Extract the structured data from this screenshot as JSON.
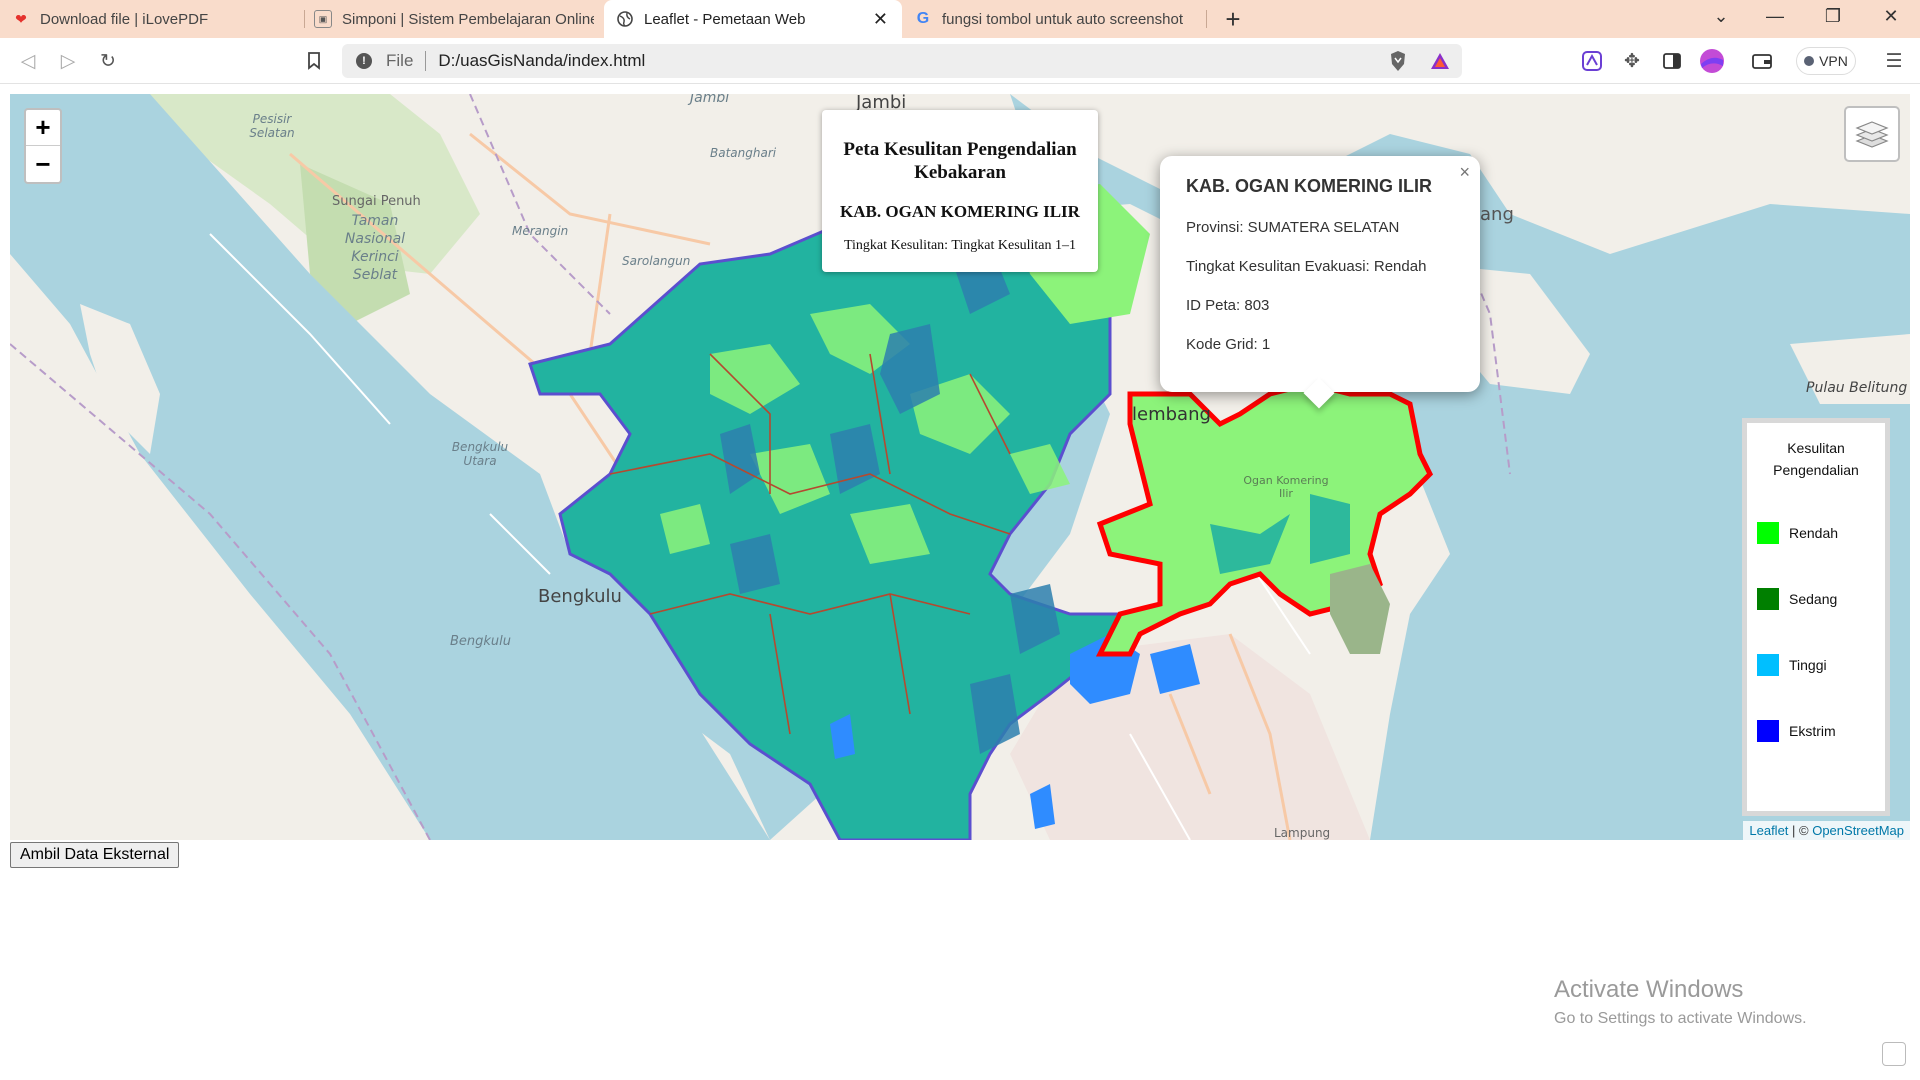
{
  "browser": {
    "tabs": [
      {
        "title": "Download file | iLovePDF",
        "icon": "heart-icon",
        "active": false
      },
      {
        "title": "Simponi | Sistem Pembelajaran Online",
        "icon": "simponi-icon",
        "active": false
      },
      {
        "title": "Leaflet - Pemetaan Web",
        "icon": "globe-icon",
        "active": true
      },
      {
        "title": "fungsi tombol untuk auto screenshot",
        "icon": "google-icon",
        "active": false
      }
    ],
    "address": {
      "scheme_label": "File",
      "url": "D:/uasGisNanda/index.html"
    },
    "vpn_label": "VPN"
  },
  "map": {
    "labels": {
      "jambi": "Jambi",
      "pesisir_selatan": "Pesisir Selatan",
      "batanghari": "Batanghari",
      "sungai_penuh": "Sungai Penuh",
      "kerinci": "Taman Nasional Kerinci Seblat",
      "merangin": "Merangin",
      "sarolangun": "Sarolangun",
      "bengkulu_utara": "Bengkulu Utara",
      "bengkulu_city": "Bengkulu",
      "bengkulu_prov": "Bengkulu",
      "palembang": "lembang",
      "ogan": "Ogan Komering Ilir",
      "bangka": "ang",
      "belitung": "Pulau Belitung",
      "lampung": "Lampung"
    },
    "info": {
      "title": "Peta Kesulitan Pengendalian Kebakaran",
      "region": "KAB. OGAN KOMERING ILIR",
      "level_text": "Tingkat Kesulitan: Tingkat Kesulitan 1–1"
    },
    "popup": {
      "title": "KAB. OGAN KOMERING ILIR",
      "provinsi": "Provinsi: SUMATERA SELATAN",
      "tingkat": "Tingkat Kesulitan Evakuasi: Rendah",
      "id_peta": "ID Peta: 803",
      "kode_grid": "Kode Grid: 1",
      "close_label": "×"
    },
    "legend": {
      "title": "Kesulitan Pengendalian",
      "items": [
        {
          "label": "Rendah",
          "color": "#00ff00"
        },
        {
          "label": "Sedang",
          "color": "#007f00"
        },
        {
          "label": "Tinggi",
          "color": "#00bfff"
        },
        {
          "label": "Ekstrim",
          "color": "#0000ff"
        }
      ]
    },
    "attribution": {
      "leaflet": "Leaflet",
      "sep": " | © ",
      "osm": "OpenStreetMap"
    },
    "zoom_in": "+",
    "zoom_out": "−",
    "colors": {
      "teal_fill": "#22b3a0",
      "light_green": "#8cf37a",
      "highlight": "#ff0000",
      "water": "#aad3df"
    }
  },
  "button": {
    "label": "Ambil Data Eksternal"
  },
  "watermark": {
    "line1": "Activate Windows",
    "line2": "Go to Settings to activate Windows."
  }
}
